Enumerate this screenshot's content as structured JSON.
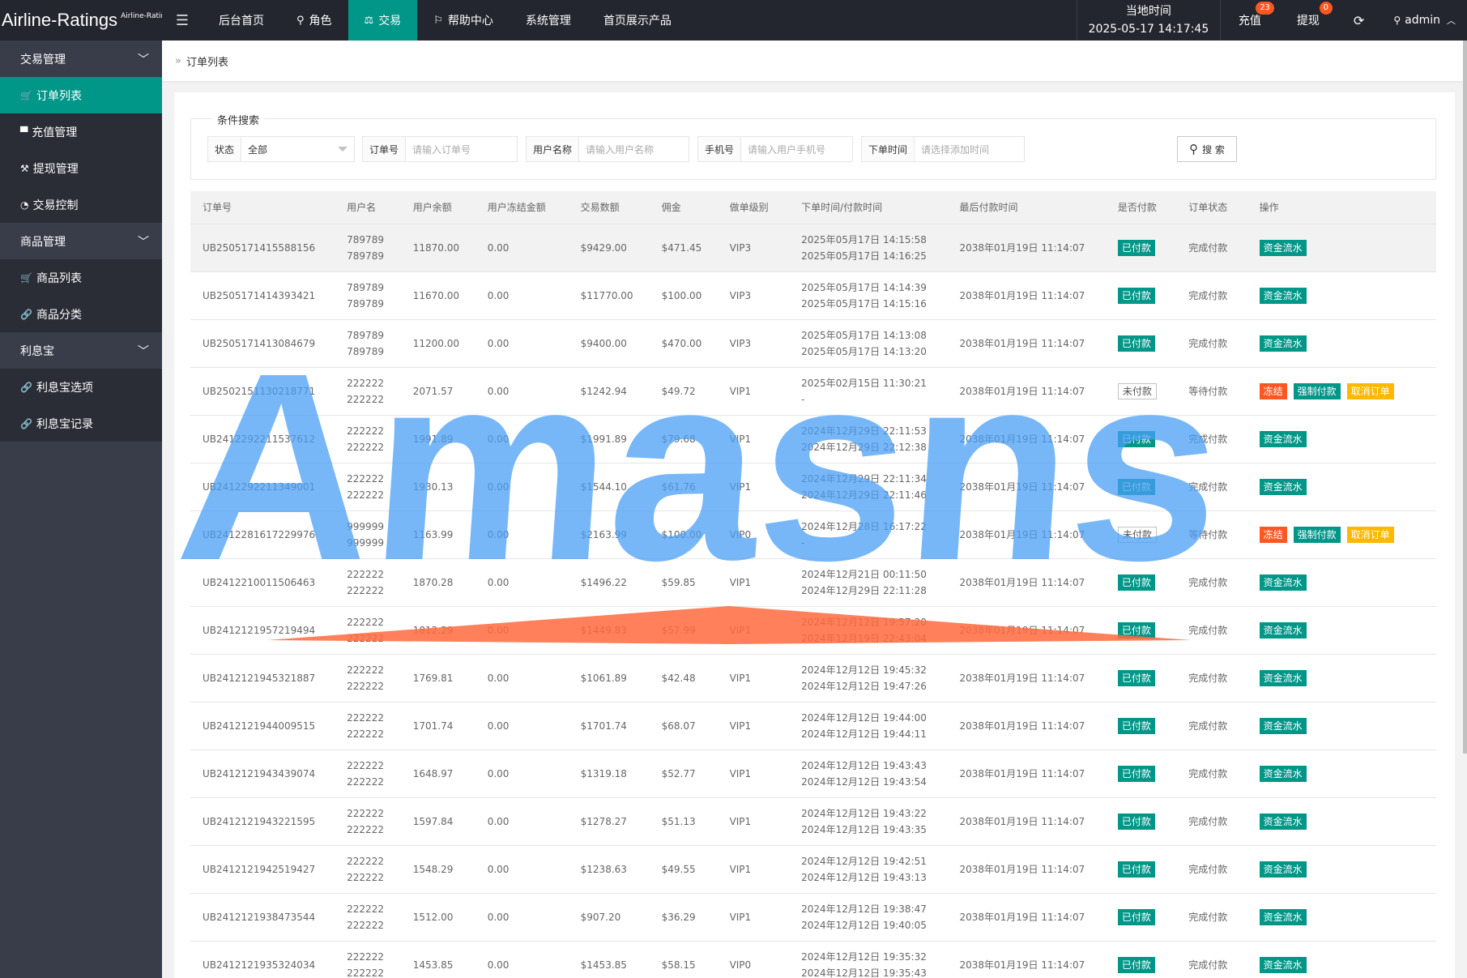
{
  "brand": {
    "name": "Airline-Ratings",
    "sub": "Airline-Ratings"
  },
  "nav": [
    {
      "label": "后台首页",
      "icon": ""
    },
    {
      "label": "角色",
      "icon": "user-icon"
    },
    {
      "label": "交易",
      "icon": "scale-icon"
    },
    {
      "label": "帮助中心",
      "icon": "flag-icon"
    },
    {
      "label": "系统管理",
      "icon": ""
    },
    {
      "label": "首页展示产品",
      "icon": ""
    }
  ],
  "active_nav_index": 2,
  "topbar": {
    "time_label": "当地时间",
    "time_value": "2025-05-17 14:17:45",
    "recharge_label": "充值",
    "recharge_badge": "23",
    "withdraw_label": "提现",
    "withdraw_badge": "0",
    "user": "admin"
  },
  "sidebar": {
    "groups": [
      {
        "label": "交易管理",
        "items": [
          {
            "label": "订单列表",
            "icon": "cart-icon",
            "active": true
          },
          {
            "label": "充值管理",
            "icon": "card-icon"
          },
          {
            "label": "提现管理",
            "icon": "gavel-icon"
          },
          {
            "label": "交易控制",
            "icon": "gauge-icon"
          }
        ]
      },
      {
        "label": "商品管理",
        "items": [
          {
            "label": "商品列表",
            "icon": "cart-icon"
          },
          {
            "label": "商品分类",
            "icon": "link-icon"
          }
        ]
      },
      {
        "label": "利息宝",
        "items": [
          {
            "label": "利息宝选项",
            "icon": "link-icon"
          },
          {
            "label": "利息宝记录",
            "icon": "link-icon"
          }
        ]
      }
    ]
  },
  "breadcrumb": "订单列表",
  "search": {
    "legend": "条件搜索",
    "status_label": "状态",
    "status_value": "全部",
    "order_label": "订单号",
    "order_placeholder": "请输入订单号",
    "username_label": "用户名称",
    "username_placeholder": "请输入用户名称",
    "phone_label": "手机号",
    "phone_placeholder": "请输入用户手机号",
    "time_label": "下单时间",
    "time_placeholder": "请选择添加时间",
    "button": "搜 索"
  },
  "table": {
    "columns": [
      "订单号",
      "用户名",
      "用户余额",
      "用户冻结金额",
      "交易数额",
      "佣金",
      "做单级别",
      "下单时间/付款时间",
      "最后付款时间",
      "是否付款",
      "订单状态",
      "操作"
    ],
    "rows": [
      {
        "id": "UB2505171415588156",
        "u1": "789789",
        "u2": "789789",
        "balance": "11870.00",
        "frozen": "0.00",
        "amount": "$9429.00",
        "comm": "$471.45",
        "level": "VIP3",
        "t1": "2025年05月17日 14:15:58",
        "t2": "2025年05月17日 14:16:25",
        "last": "2038年01月19日 11:14:07",
        "paid": "已付款",
        "status": "完成付款",
        "actions": [
          "资金流水"
        ]
      },
      {
        "id": "UB2505171414393421",
        "u1": "789789",
        "u2": "789789",
        "balance": "11670.00",
        "frozen": "0.00",
        "amount": "$11770.00",
        "comm": "$100.00",
        "level": "VIP3",
        "t1": "2025年05月17日 14:14:39",
        "t2": "2025年05月17日 14:15:16",
        "last": "2038年01月19日 11:14:07",
        "paid": "已付款",
        "status": "完成付款",
        "actions": [
          "资金流水"
        ]
      },
      {
        "id": "UB2505171413084679",
        "u1": "789789",
        "u2": "789789",
        "balance": "11200.00",
        "frozen": "0.00",
        "amount": "$9400.00",
        "comm": "$470.00",
        "level": "VIP3",
        "t1": "2025年05月17日 14:13:08",
        "t2": "2025年05月17日 14:13:20",
        "last": "2038年01月19日 11:14:07",
        "paid": "已付款",
        "status": "完成付款",
        "actions": [
          "资金流水"
        ]
      },
      {
        "id": "UB2502151130218771",
        "u1": "222222",
        "u2": "222222",
        "balance": "2071.57",
        "frozen": "0.00",
        "amount": "$1242.94",
        "comm": "$49.72",
        "level": "VIP1",
        "t1": "2025年02月15日 11:30:21",
        "t2": "-",
        "last": "2038年01月19日 11:14:07",
        "paid": "未付款",
        "status": "等待付款",
        "actions": [
          "冻结",
          "强制付款",
          "取消订单"
        ]
      },
      {
        "id": "UB2412292211537612",
        "u1": "222222",
        "u2": "222222",
        "balance": "1991.89",
        "frozen": "0.00",
        "amount": "$1991.89",
        "comm": "$79.68",
        "level": "VIP1",
        "t1": "2024年12月29日 22:11:53",
        "t2": "2024年12月29日 22:12:38",
        "last": "2038年01月19日 11:14:07",
        "paid": "已付款",
        "status": "完成付款",
        "actions": [
          "资金流水"
        ]
      },
      {
        "id": "UB2412292211349001",
        "u1": "222222",
        "u2": "222222",
        "balance": "1930.13",
        "frozen": "0.00",
        "amount": "$1544.10",
        "comm": "$61.76",
        "level": "VIP1",
        "t1": "2024年12月29日 22:11:34",
        "t2": "2024年12月29日 22:11:46",
        "last": "2038年01月19日 11:14:07",
        "paid": "已付款",
        "status": "完成付款",
        "actions": [
          "资金流水"
        ]
      },
      {
        "id": "UB2412281617229976",
        "u1": "999999",
        "u2": "999999",
        "balance": "1163.99",
        "frozen": "0.00",
        "amount": "$2163.99",
        "comm": "$100.00",
        "level": "VIP0",
        "t1": "2024年12月28日 16:17:22",
        "t2": "-",
        "last": "2038年01月19日 11:14:07",
        "paid": "未付款",
        "status": "等待付款",
        "actions": [
          "冻结",
          "强制付款",
          "取消订单"
        ]
      },
      {
        "id": "UB2412210011506463",
        "u1": "222222",
        "u2": "222222",
        "balance": "1870.28",
        "frozen": "0.00",
        "amount": "$1496.22",
        "comm": "$59.85",
        "level": "VIP1",
        "t1": "2024年12月21日 00:11:50",
        "t2": "2024年12月29日 22:11:28",
        "last": "2038年01月19日 11:14:07",
        "paid": "已付款",
        "status": "完成付款",
        "actions": [
          "资金流水"
        ]
      },
      {
        "id": "UB2412121957219494",
        "u1": "222222",
        "u2": "222222",
        "balance": "1812.29",
        "frozen": "0.00",
        "amount": "$1449.83",
        "comm": "$57.99",
        "level": "VIP1",
        "t1": "2024年12月12日 19:57:20",
        "t2": "2024年12月19日 22:43:04",
        "last": "2038年01月19日 11:14:07",
        "paid": "已付款",
        "status": "完成付款",
        "actions": [
          "资金流水"
        ]
      },
      {
        "id": "UB2412121945321887",
        "u1": "222222",
        "u2": "222222",
        "balance": "1769.81",
        "frozen": "0.00",
        "amount": "$1061.89",
        "comm": "$42.48",
        "level": "VIP1",
        "t1": "2024年12月12日 19:45:32",
        "t2": "2024年12月12日 19:47:26",
        "last": "2038年01月19日 11:14:07",
        "paid": "已付款",
        "status": "完成付款",
        "actions": [
          "资金流水"
        ]
      },
      {
        "id": "UB2412121944009515",
        "u1": "222222",
        "u2": "222222",
        "balance": "1701.74",
        "frozen": "0.00",
        "amount": "$1701.74",
        "comm": "$68.07",
        "level": "VIP1",
        "t1": "2024年12月12日 19:44:00",
        "t2": "2024年12月12日 19:44:11",
        "last": "2038年01月19日 11:14:07",
        "paid": "已付款",
        "status": "完成付款",
        "actions": [
          "资金流水"
        ]
      },
      {
        "id": "UB2412121943439074",
        "u1": "222222",
        "u2": "222222",
        "balance": "1648.97",
        "frozen": "0.00",
        "amount": "$1319.18",
        "comm": "$52.77",
        "level": "VIP1",
        "t1": "2024年12月12日 19:43:43",
        "t2": "2024年12月12日 19:43:54",
        "last": "2038年01月19日 11:14:07",
        "paid": "已付款",
        "status": "完成付款",
        "actions": [
          "资金流水"
        ]
      },
      {
        "id": "UB2412121943221595",
        "u1": "222222",
        "u2": "222222",
        "balance": "1597.84",
        "frozen": "0.00",
        "amount": "$1278.27",
        "comm": "$51.13",
        "level": "VIP1",
        "t1": "2024年12月12日 19:43:22",
        "t2": "2024年12月12日 19:43:35",
        "last": "2038年01月19日 11:14:07",
        "paid": "已付款",
        "status": "完成付款",
        "actions": [
          "资金流水"
        ]
      },
      {
        "id": "UB2412121942519427",
        "u1": "222222",
        "u2": "222222",
        "balance": "1548.29",
        "frozen": "0.00",
        "amount": "$1238.63",
        "comm": "$49.55",
        "level": "VIP1",
        "t1": "2024年12月12日 19:42:51",
        "t2": "2024年12月12日 19:43:13",
        "last": "2038年01月19日 11:14:07",
        "paid": "已付款",
        "status": "完成付款",
        "actions": [
          "资金流水"
        ]
      },
      {
        "id": "UB2412121938473544",
        "u1": "222222",
        "u2": "222222",
        "balance": "1512.00",
        "frozen": "0.00",
        "amount": "$907.20",
        "comm": "$36.29",
        "level": "VIP1",
        "t1": "2024年12月12日 19:38:47",
        "t2": "2024年12月12日 19:40:05",
        "last": "2038年01月19日 11:14:07",
        "paid": "已付款",
        "status": "完成付款",
        "actions": [
          "资金流水"
        ]
      },
      {
        "id": "UB2412121935324034",
        "u1": "222222",
        "u2": "222222",
        "balance": "1453.85",
        "frozen": "0.00",
        "amount": "$1453.85",
        "comm": "$58.15",
        "level": "VIP0",
        "t1": "2024年12月12日 19:35:32",
        "t2": "2024年12月12日 19:35:43",
        "last": "2038年01月19日 11:14:07",
        "paid": "已付款",
        "status": "完成付款",
        "actions": [
          "资金流水"
        ]
      }
    ]
  },
  "watermark": {
    "text": "Amasns",
    "color": "#4a9ff5",
    "accent": "#ff6a3d"
  },
  "colors": {
    "accent": "#009688",
    "danger": "#ff5722",
    "warn": "#ffb800",
    "topbar": "#23262e",
    "sidebar": "#393d49"
  }
}
